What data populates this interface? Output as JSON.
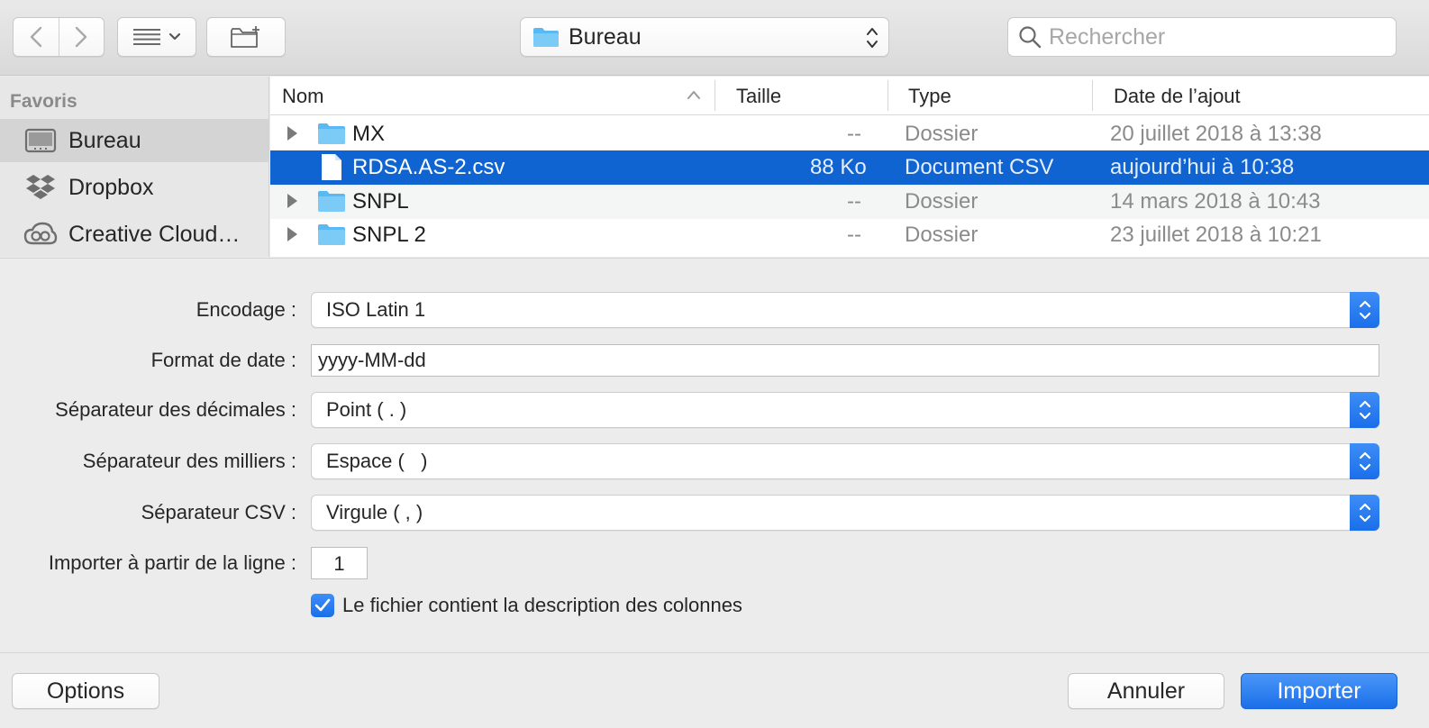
{
  "toolbar": {
    "back_icon": "chevron-left-icon",
    "forward_icon": "chevron-right-icon",
    "view_icon": "list-view-icon",
    "new_folder_icon": "new-folder-icon",
    "location": "Bureau",
    "search_placeholder": "Rechercher"
  },
  "sidebar": {
    "section_title": "Favoris",
    "items": [
      {
        "label": "Bureau",
        "icon": "desktop-icon",
        "selected": true
      },
      {
        "label": "Dropbox",
        "icon": "dropbox-icon",
        "selected": false
      },
      {
        "label": "Creative Cloud…",
        "icon": "creative-cloud-icon",
        "selected": false
      }
    ]
  },
  "filelist": {
    "columns": {
      "name": "Nom",
      "size": "Taille",
      "type": "Type",
      "date": "Date de l’ajout"
    },
    "rows": [
      {
        "name": "MX",
        "size": "--",
        "type": "Dossier",
        "date": "20 juillet 2018 à 13:38",
        "kind": "folder"
      },
      {
        "name": "RDSA.AS-2.csv",
        "size": "88 Ko",
        "type": "Document CSV",
        "date": "aujourd’hui à 10:38",
        "kind": "file"
      },
      {
        "name": "SNPL",
        "size": "--",
        "type": "Dossier",
        "date": "14 mars 2018 à 10:43",
        "kind": "folder"
      },
      {
        "name": "SNPL 2",
        "size": "--",
        "type": "Dossier",
        "date": "23 juillet 2018 à 10:21",
        "kind": "folder"
      }
    ]
  },
  "form": {
    "encoding_label": "Encodage :",
    "encoding_value": "ISO Latin 1",
    "date_format_label": "Format de date :",
    "date_format_value": "yyyy-MM-dd",
    "decimal_sep_label": "Séparateur des décimales :",
    "decimal_sep_value": "Point ( . )",
    "thousands_sep_label": "Séparateur des milliers :",
    "thousands_sep_value": "Espace (   )",
    "csv_sep_label": "Séparateur CSV :",
    "csv_sep_value": "Virgule ( , )",
    "start_line_label": "Importer à partir de la ligne :",
    "start_line_value": "1",
    "header_checkbox_label": "Le fichier contient la description des colonnes",
    "header_checkbox_checked": true
  },
  "footer": {
    "options_label": "Options",
    "cancel_label": "Annuler",
    "import_label": "Importer"
  },
  "colors": {
    "selection": "#0f64d2",
    "accent": "#1b6fe9",
    "folder": "#5ab8f2"
  }
}
